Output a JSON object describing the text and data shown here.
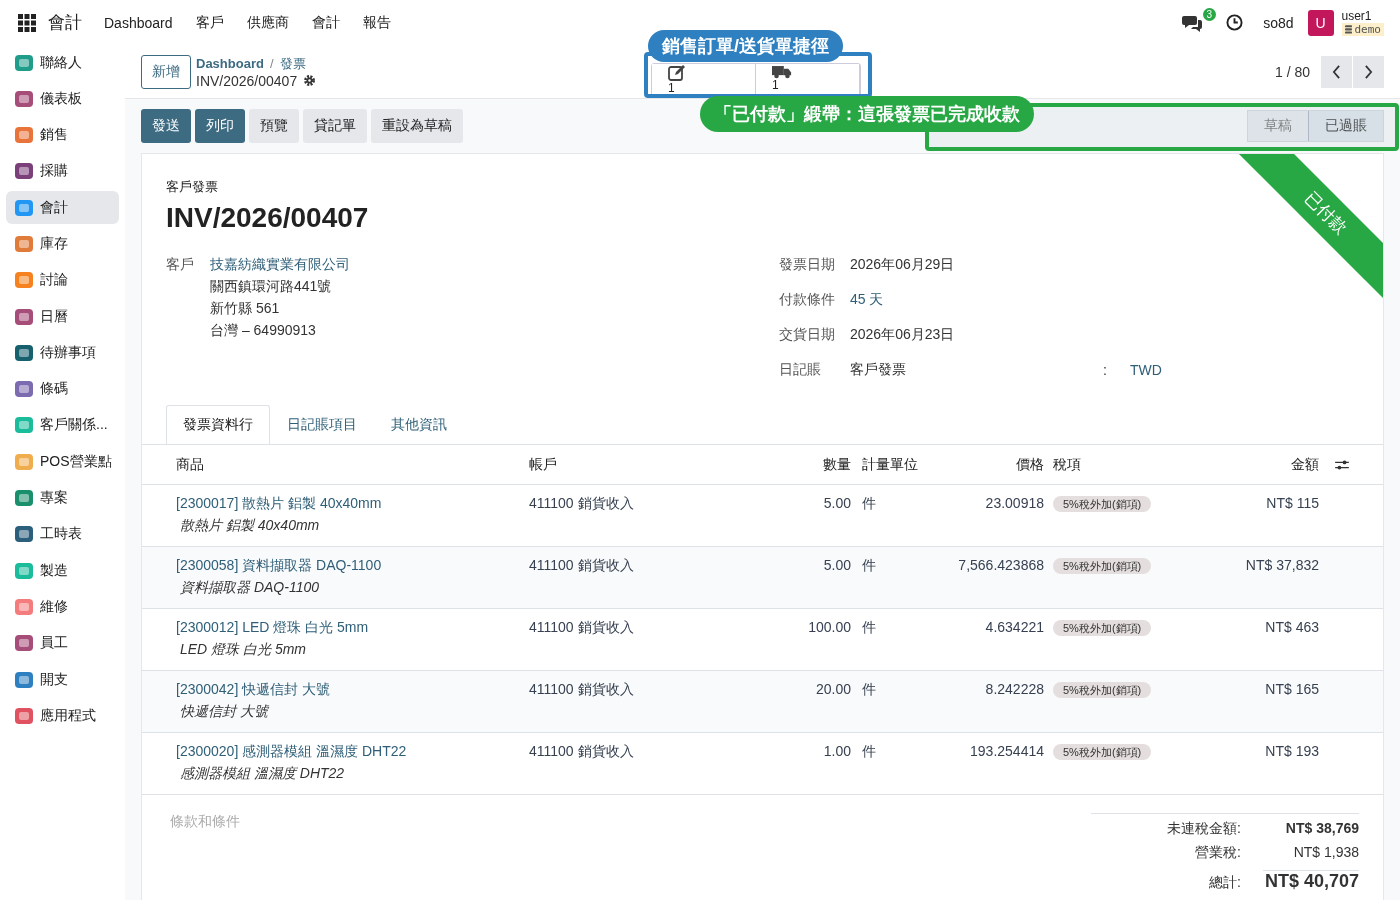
{
  "topbar": {
    "app": "會計",
    "menu": [
      "Dashboard",
      "客戶",
      "供應商",
      "會計",
      "報告"
    ],
    "chat_count": "3",
    "company": "so8d",
    "avatar": "U",
    "user": "user1",
    "database": "demo"
  },
  "sidebar": {
    "items": [
      {
        "label": "聯絡人",
        "selected": false
      },
      {
        "label": "儀表板",
        "selected": false
      },
      {
        "label": "銷售",
        "selected": false
      },
      {
        "label": "採購",
        "selected": false
      },
      {
        "label": "會計",
        "selected": true
      },
      {
        "label": "庫存",
        "selected": false
      },
      {
        "label": "討論",
        "selected": false
      },
      {
        "label": "日曆",
        "selected": false
      },
      {
        "label": "待辦事項",
        "selected": false
      },
      {
        "label": "條碼",
        "selected": false
      },
      {
        "label": "客戶關係...",
        "selected": false
      },
      {
        "label": "POS營業點",
        "selected": false
      },
      {
        "label": "專案",
        "selected": false
      },
      {
        "label": "工時表",
        "selected": false
      },
      {
        "label": "製造",
        "selected": false
      },
      {
        "label": "維修",
        "selected": false
      },
      {
        "label": "員工",
        "selected": false
      },
      {
        "label": "開支",
        "selected": false
      },
      {
        "label": "應用程式",
        "selected": false
      }
    ]
  },
  "control": {
    "new_button": "新增",
    "breadcrumb": {
      "parent": "Dashboard",
      "separator": "/",
      "current": "發票"
    },
    "record": "INV/2026/00407",
    "smart_buttons": [
      {
        "count": "1"
      },
      {
        "count": "1"
      }
    ],
    "pager": "1 / 80"
  },
  "actions": [
    {
      "label": "發送",
      "primary": true
    },
    {
      "label": "列印",
      "primary": true
    },
    {
      "label": "預覽",
      "primary": false
    },
    {
      "label": "貸記單",
      "primary": false
    },
    {
      "label": "重設為草稿",
      "primary": false
    }
  ],
  "status": [
    {
      "label": "草稿",
      "selected": false
    },
    {
      "label": "已過賬",
      "selected": true
    }
  ],
  "annotations": [
    {
      "text": "銷售訂單/送貨單捷徑",
      "color": "#2f80c0"
    },
    {
      "text": "「已付款」緞帶：這張發票已完成收款",
      "color": "#28a745"
    }
  ],
  "sheet": {
    "ribbon": "已付款",
    "type": "客戶發票",
    "name": "INV/2026/00407",
    "customer_label": "客戶",
    "customer": "技嘉紡織實業有限公司",
    "address": [
      "關西鎮環河路441號",
      "新竹縣 561",
      "台灣 – 64990913"
    ],
    "fields": [
      {
        "label": "發票日期",
        "value": "2026年06月29日",
        "link": false
      },
      {
        "label": "付款條件",
        "value": "45 天",
        "link": true
      },
      {
        "label": "交貨日期",
        "value": "2026年06月23日",
        "link": false
      }
    ],
    "journal": {
      "label": "日記賬",
      "value": "客戶發票",
      "separator": ":",
      "currency": "TWD"
    },
    "tabs": [
      {
        "label": "發票資料行",
        "selected": true
      },
      {
        "label": "日記賬項目",
        "selected": false
      },
      {
        "label": "其他資訊",
        "selected": false
      }
    ],
    "table": {
      "columns": [
        "商品",
        "帳戶",
        "數量",
        "計量單位",
        "價格",
        "稅項",
        "金額"
      ],
      "rows": [
        {
          "product": "[2300017] 散熱片 鋁製 40x40mm",
          "description": "散熱片 鋁製 40x40mm",
          "account": "411100 銷貨收入",
          "quantity": "5.00",
          "unit": "件",
          "price": "23.00918",
          "tax": "5%稅外加(銷項)",
          "amount": "NT$ 115"
        },
        {
          "product": "[2300058] 資料擷取器 DAQ-1100",
          "description": "資料擷取器 DAQ-1100",
          "account": "411100 銷貨收入",
          "quantity": "5.00",
          "unit": "件",
          "price": "7,566.423868",
          "tax": "5%稅外加(銷項)",
          "amount": "NT$ 37,832"
        },
        {
          "product": "[2300012] LED 燈珠 白光 5mm",
          "description": "LED 燈珠 白光 5mm",
          "account": "411100 銷貨收入",
          "quantity": "100.00",
          "unit": "件",
          "price": "4.634221",
          "tax": "5%稅外加(銷項)",
          "amount": "NT$ 463"
        },
        {
          "product": "[2300042] 快遞信封 大號",
          "description": "快遞信封 大號",
          "account": "411100 銷貨收入",
          "quantity": "20.00",
          "unit": "件",
          "price": "8.242228",
          "tax": "5%稅外加(銷項)",
          "amount": "NT$ 165"
        },
        {
          "product": "[2300020] 感測器模組 溫濕度 DHT22",
          "description": "感測器模組 溫濕度 DHT22",
          "account": "411100 銷貨收入",
          "quantity": "1.00",
          "unit": "件",
          "price": "193.254414",
          "tax": "5%稅外加(銷項)",
          "amount": "NT$ 193"
        }
      ]
    },
    "terms_placeholder": "條款和條件",
    "totals": [
      {
        "label": "未連稅金額:",
        "value": "NT$ 38,769",
        "kind": "subtotal"
      },
      {
        "label": "營業稅:",
        "value": "NT$ 1,938",
        "kind": "tax"
      },
      {
        "label": "總計:",
        "value": "NT$ 40,707",
        "kind": "total"
      }
    ]
  }
}
